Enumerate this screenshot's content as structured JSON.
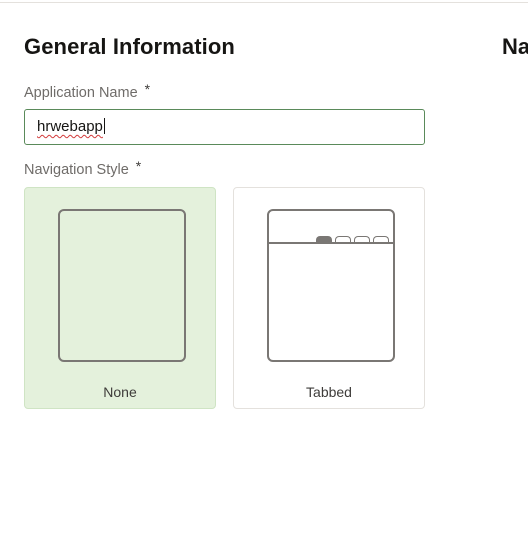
{
  "general_section": {
    "title": "General Information",
    "next_section_title_partial": "Na"
  },
  "application_name": {
    "label": "Application Name",
    "required_marker": "*",
    "value": "hrwebapp"
  },
  "navigation_style": {
    "label": "Navigation Style",
    "required_marker": "*",
    "selected": "None",
    "options": [
      {
        "label": "None",
        "icon": "blank-layout-icon",
        "selected": true
      },
      {
        "label": "Tabbed",
        "icon": "tabbed-layout-icon",
        "selected": false
      }
    ]
  },
  "colors": {
    "selected_card_bg": "#e4f1dc",
    "input_focus_border": "#5a8a5a",
    "icon_stroke": "#7a7774"
  }
}
